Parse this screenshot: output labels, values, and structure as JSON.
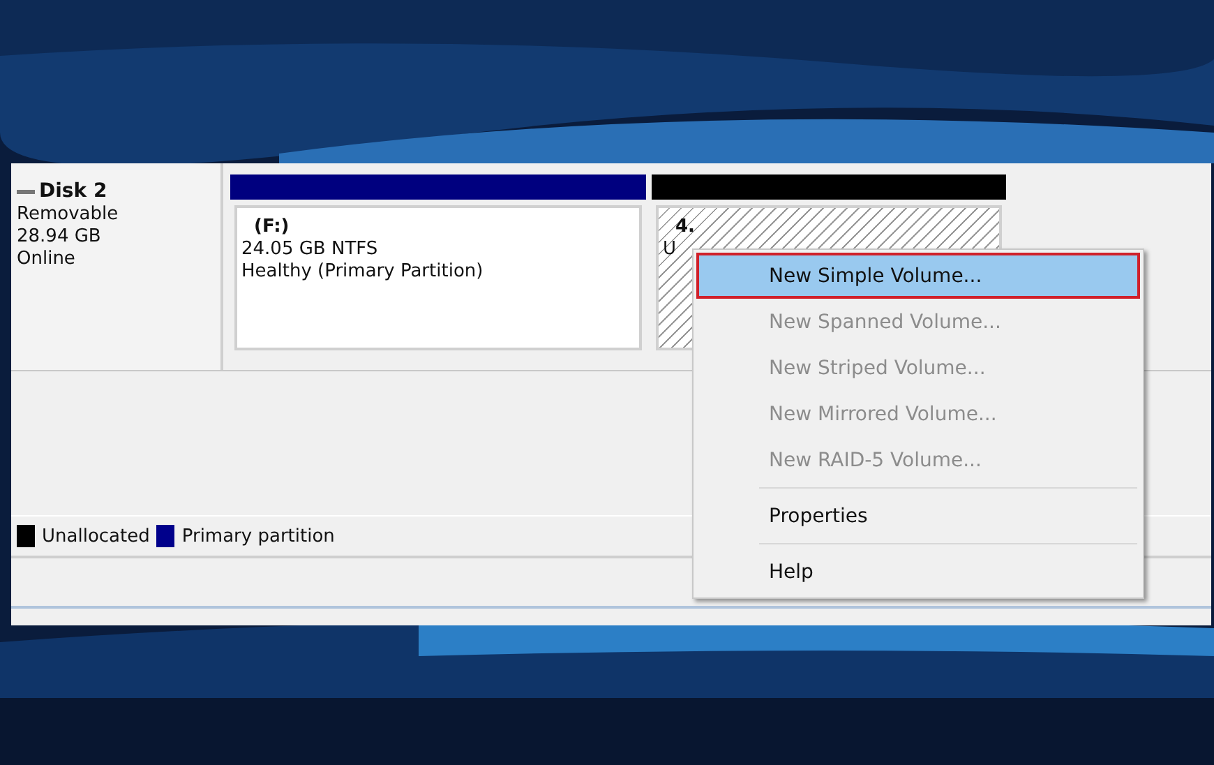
{
  "disk": {
    "name": "Disk 2",
    "type": "Removable",
    "size": "28.94 GB",
    "status": "Online"
  },
  "partitions": [
    {
      "kind": "primary",
      "color": "#00007f",
      "lines": [
        "(F:)",
        "24.05 GB NTFS",
        "Healthy (Primary Partition)"
      ]
    },
    {
      "kind": "unallocated",
      "color": "#000000",
      "lines": [
        "4.",
        "U"
      ]
    }
  ],
  "legend": [
    {
      "label": "Unallocated",
      "color": "#000000"
    },
    {
      "label": "Primary partition",
      "color": "#00008b"
    }
  ],
  "context_menu": {
    "sections": [
      [
        {
          "label": "New Simple Volume...",
          "selected": true,
          "disabled": false
        },
        {
          "label": "New Spanned Volume...",
          "selected": false,
          "disabled": true
        },
        {
          "label": "New Striped Volume...",
          "selected": false,
          "disabled": true
        },
        {
          "label": "New Mirrored Volume...",
          "selected": false,
          "disabled": true
        },
        {
          "label": "New RAID-5 Volume...",
          "selected": false,
          "disabled": true
        }
      ],
      [
        {
          "label": "Properties",
          "selected": false,
          "disabled": false
        }
      ],
      [
        {
          "label": "Help",
          "selected": false,
          "disabled": false
        }
      ]
    ]
  }
}
